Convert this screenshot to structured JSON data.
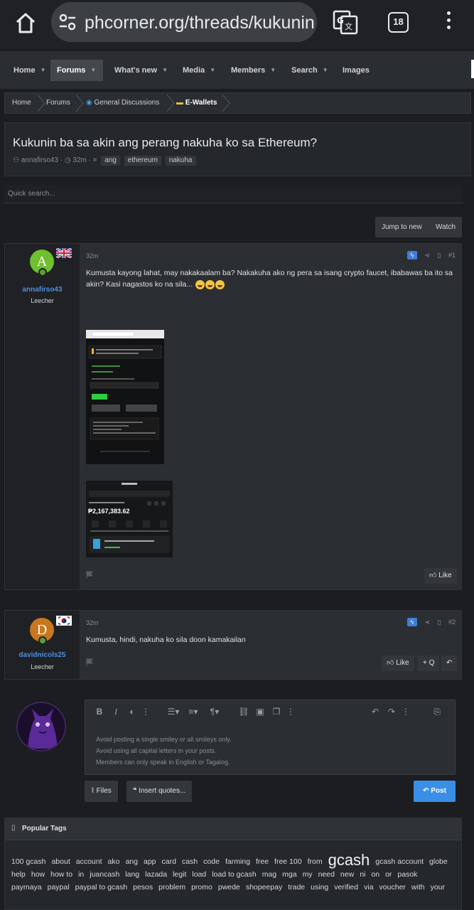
{
  "browser": {
    "url": "phcorner.org/threads/kukunin",
    "tab_count": "18"
  },
  "nav": {
    "items": [
      {
        "label": "Home",
        "active": false
      },
      {
        "label": "Forums",
        "active": true
      },
      {
        "label": "What's new",
        "active": false
      },
      {
        "label": "Media",
        "active": false
      },
      {
        "label": "Members",
        "active": false
      },
      {
        "label": "Search",
        "active": false
      },
      {
        "label": "Images",
        "active": false
      }
    ]
  },
  "breadcrumb": {
    "items": [
      "Home",
      "Forums",
      "General Discussions",
      "E-Wallets"
    ]
  },
  "thread": {
    "title": "Kukunin ba sa akin ang perang nakuha ko sa Ethereum?",
    "author": "annafirso43",
    "time": "32m",
    "tags": [
      "ang",
      "ethereum",
      "nakuha"
    ]
  },
  "quick_search": {
    "placeholder": "Quick search..."
  },
  "thread_actions": {
    "jump_to_new": "Jump to new",
    "watch": "Watch"
  },
  "posts": [
    {
      "username": "annafirso43",
      "user_title": "Leecher",
      "avatar_letter": "A",
      "avatar_color": "#6fbf2e",
      "time": "32m",
      "number": "#1",
      "text": "Kumusta kayong lahat, may nakakaalam ba? Nakakuha ako ng pera sa isang crypto faucet, ibabawas ba ito sa akin? Kasi nagastos ko na sila...",
      "like_label": "Like",
      "wallet_balance": "₱2,167,383.62"
    },
    {
      "username": "davidnicols25",
      "user_title": "Leecher",
      "avatar_letter": "D",
      "avatar_color": "#c9771f",
      "time": "32m",
      "number": "#2",
      "text": "Kumusta, hindi, nakuha ko sila doon kamakailan",
      "like_label": "Like",
      "quote_label": "+ Q"
    }
  ],
  "editor": {
    "hints": [
      "Avoid posting a single smiley or all smileys only.",
      "Avoid using all capital letters in your posts.",
      "Members can only speak in English or Tagalog."
    ],
    "files_label": "Files",
    "insert_quotes_label": "Insert quotes...",
    "post_label": "Post"
  },
  "popular_tags": {
    "title": "Popular Tags",
    "tags": [
      {
        "label": "100 gcash"
      },
      {
        "label": "about"
      },
      {
        "label": "account"
      },
      {
        "label": "ako"
      },
      {
        "label": "ang"
      },
      {
        "label": "app"
      },
      {
        "label": "card"
      },
      {
        "label": "cash"
      },
      {
        "label": "code"
      },
      {
        "label": "farming"
      },
      {
        "label": "free"
      },
      {
        "label": "free 100"
      },
      {
        "label": "from"
      },
      {
        "label": "gcash",
        "big": true
      },
      {
        "label": "gcash account"
      },
      {
        "label": "globe"
      },
      {
        "label": "help"
      },
      {
        "label": "how"
      },
      {
        "label": "how to"
      },
      {
        "label": "in"
      },
      {
        "label": "juancash"
      },
      {
        "label": "lang"
      },
      {
        "label": "lazada"
      },
      {
        "label": "legit"
      },
      {
        "label": "load"
      },
      {
        "label": "load to gcash"
      },
      {
        "label": "mag"
      },
      {
        "label": "mga"
      },
      {
        "label": "my"
      },
      {
        "label": "need"
      },
      {
        "label": "new"
      },
      {
        "label": "ni"
      },
      {
        "label": "on"
      },
      {
        "label": "or"
      },
      {
        "label": "pasok"
      },
      {
        "label": "paymaya"
      },
      {
        "label": "paypal"
      },
      {
        "label": "paypal to gcash"
      },
      {
        "label": "pesos"
      },
      {
        "label": "problem"
      },
      {
        "label": "promo"
      },
      {
        "label": "pwede"
      },
      {
        "label": "shopeepay"
      },
      {
        "label": "trade"
      },
      {
        "label": "using"
      },
      {
        "label": "verified"
      },
      {
        "label": "via"
      },
      {
        "label": "voucher"
      },
      {
        "label": "with"
      },
      {
        "label": "your"
      }
    ]
  }
}
